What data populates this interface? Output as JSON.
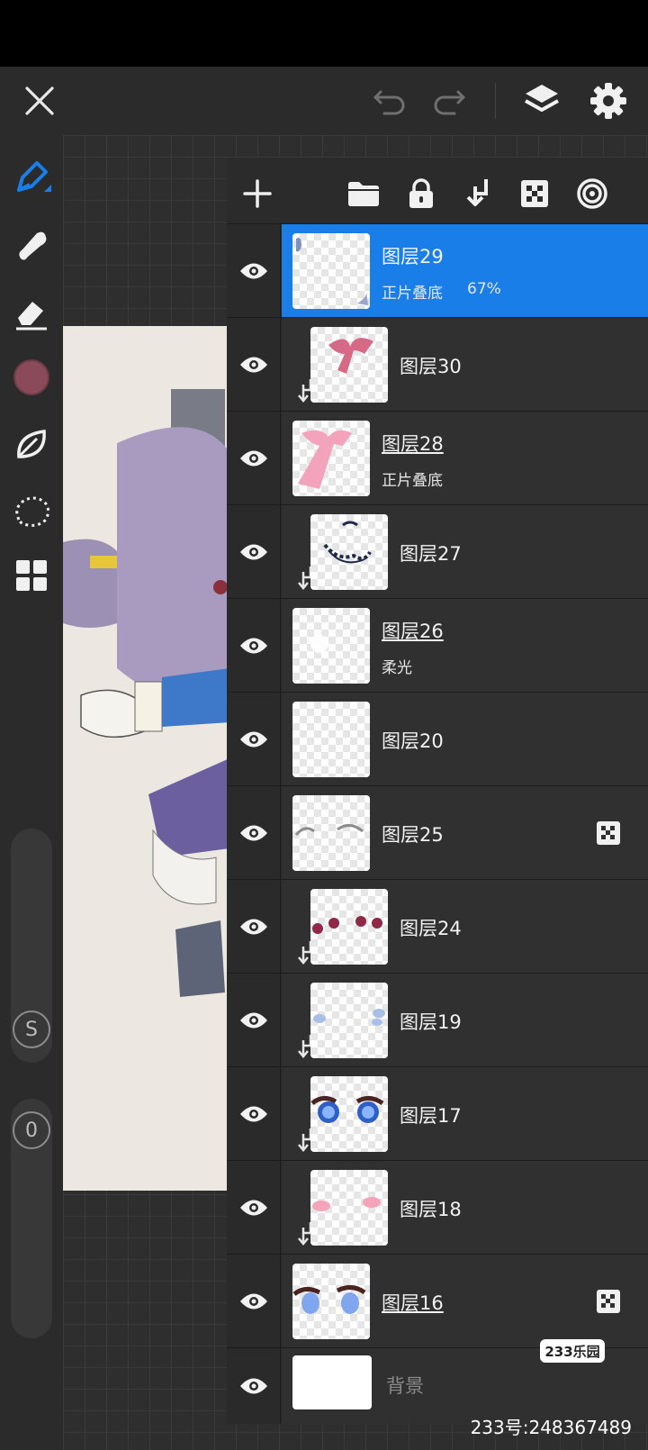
{
  "topbar": {
    "close_icon": "close-icon",
    "undo_icon": "undo-icon",
    "redo_icon": "redo-icon",
    "layers_icon": "layers-icon",
    "settings_icon": "gear-icon"
  },
  "left_tools": {
    "items": [
      "pen-tool-icon",
      "smudge-icon",
      "eraser-icon",
      "color-swatch",
      "blend-leaf-icon",
      "lasso-icon",
      "grid-icon"
    ],
    "current_color": "#8b4a5a",
    "accent": "#1a7ee8",
    "size_button": "S",
    "opacity_button": "0"
  },
  "layer_tools": [
    "add-layer-icon",
    "folder-icon",
    "lock-icon",
    "merge-down-icon",
    "alpha-lock-icon",
    "blend-icon"
  ],
  "layers": [
    {
      "name": "图层29",
      "blend": "正片叠底",
      "opacity": "67%",
      "selected": true,
      "clipped": false,
      "underline": false
    },
    {
      "name": "图层30",
      "blend": "",
      "opacity": "",
      "selected": false,
      "clipped": true,
      "underline": false
    },
    {
      "name": "图层28",
      "blend": "正片叠底",
      "opacity": "",
      "selected": false,
      "clipped": false,
      "underline": true
    },
    {
      "name": "图层27",
      "blend": "",
      "opacity": "",
      "selected": false,
      "clipped": true,
      "underline": false
    },
    {
      "name": "图层26",
      "blend": "柔光",
      "opacity": "",
      "selected": false,
      "clipped": false,
      "underline": true
    },
    {
      "name": "图层20",
      "blend": "",
      "opacity": "",
      "selected": false,
      "clipped": false,
      "underline": false
    },
    {
      "name": "图层25",
      "blend": "",
      "opacity": "",
      "selected": false,
      "clipped": false,
      "underline": false,
      "alpha_lock": true
    },
    {
      "name": "图层24",
      "blend": "",
      "opacity": "",
      "selected": false,
      "clipped": true,
      "underline": false
    },
    {
      "name": "图层19",
      "blend": "",
      "opacity": "",
      "selected": false,
      "clipped": true,
      "underline": false
    },
    {
      "name": "图层17",
      "blend": "",
      "opacity": "",
      "selected": false,
      "clipped": true,
      "underline": false
    },
    {
      "name": "图层18",
      "blend": "",
      "opacity": "",
      "selected": false,
      "clipped": true,
      "underline": false
    },
    {
      "name": "图层16",
      "blend": "",
      "opacity": "",
      "selected": false,
      "clipped": false,
      "underline": true,
      "alpha_lock": true
    },
    {
      "name": "背景",
      "blend": "",
      "opacity": "",
      "selected": false,
      "clipped": false,
      "underline": false,
      "background": true
    }
  ],
  "watermark": {
    "logo": "233乐园",
    "text": "233号:248367489"
  }
}
